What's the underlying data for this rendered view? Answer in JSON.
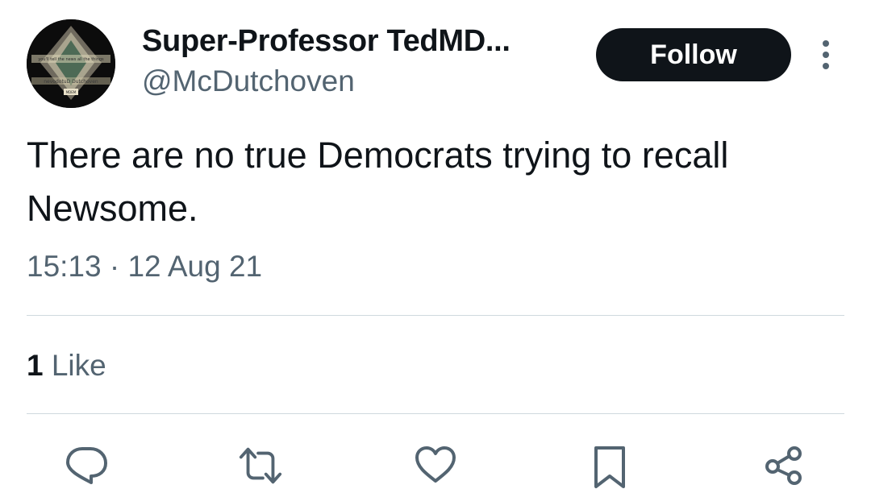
{
  "author": {
    "display_name": "Super-Professor TedMD...",
    "handle": "@McDutchoven",
    "avatar_text_top": "you'll tell the news all the things",
    "avatar_text_mid": "nevodotuD Dutchoven",
    "avatar_text_badge": "MDEM"
  },
  "follow_label": "Follow",
  "more_icon": "more-vertical-icon",
  "tweet": {
    "text": "There are no true Democrats trying to recall Newsome.",
    "timestamp": "15:13 · 12 Aug 21"
  },
  "engagement": {
    "likes_count": "1",
    "likes_label": "Like"
  },
  "actions": [
    {
      "name": "reply-icon"
    },
    {
      "name": "retweet-icon"
    },
    {
      "name": "like-icon"
    },
    {
      "name": "bookmark-icon"
    },
    {
      "name": "share-icon"
    }
  ],
  "colors": {
    "text_primary": "#0f1419",
    "text_secondary": "#536471",
    "divider": "#cfd9de",
    "button_bg": "#0f1419",
    "button_text": "#ffffff",
    "icon": "#536471"
  }
}
